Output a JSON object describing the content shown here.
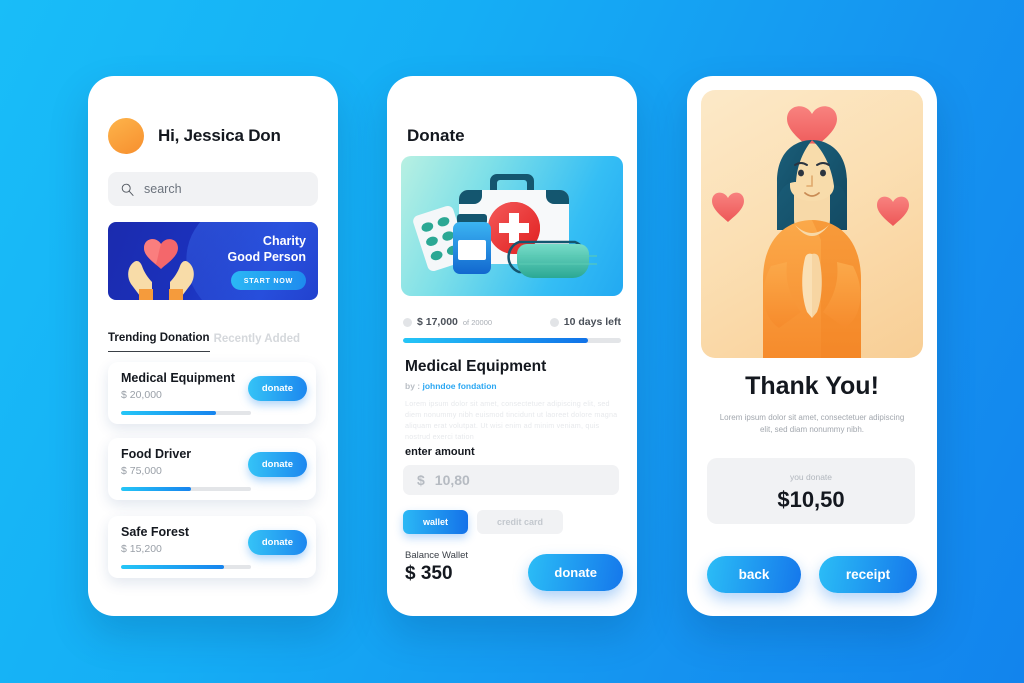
{
  "theme": {
    "bg_start": "#19BDF8",
    "bg_end": "#1284ED",
    "accent_blue": "#1C87EF",
    "accent_cyan": "#35C3F6",
    "avatar_orange": "#F78F2E",
    "heart_coral": "#F26A6A"
  },
  "screen1": {
    "greeting": "Hi, Jessica Don",
    "avatar_icon": "user-avatar",
    "search": {
      "placeholder": "search",
      "icon": "search-icon",
      "value": ""
    },
    "banner": {
      "line1": "Charity",
      "line2": "Good Person",
      "cta": "START NOW",
      "illustration": "hands-holding-heart"
    },
    "tabs": [
      {
        "label": "Trending Donation",
        "active": true
      },
      {
        "label": "Recently Added",
        "active": false
      }
    ],
    "donations": [
      {
        "title": "Medical Equipment",
        "amount": "$ 20,000",
        "progress": 73,
        "button": "donate"
      },
      {
        "title": "Food Driver",
        "amount": "$ 75,000",
        "progress": 54,
        "button": "donate"
      },
      {
        "title": "Safe Forest",
        "amount": "$ 15,200",
        "progress": 79,
        "button": "donate"
      }
    ]
  },
  "screen2": {
    "title": "Donate",
    "hero_illustration": "first-aid-kit",
    "raised_icon": "coin-icon",
    "raised_amount": "$ 17,000",
    "raised_of": "of 20000",
    "time_icon": "clock-icon",
    "time_left": "10 days left",
    "progress": 85,
    "campaign_title": "Medical Equipment",
    "by_prefix": "by : ",
    "by_name": "johndoe fondation",
    "description": "Lorem ipsum dolor sit amet, consectetuer adipiscing elit, sed diem nonummy nibh euismod tincidunt ut laoreet dolore magna aliquam erat volutpat. Ut wisi enim ad minim veniam, quis nostrud exerci tation",
    "amount_label": "enter amount",
    "amount_currency": "$",
    "amount_value": "10,80",
    "payment_methods": [
      {
        "label": "wallet",
        "active": true
      },
      {
        "label": "credit card",
        "active": false
      }
    ],
    "balance_label": "Balance Wallet",
    "balance_value": "$ 350",
    "donate_button": "donate"
  },
  "screen3": {
    "illustration": "woman-praying-with-hearts",
    "heading": "Thank You!",
    "subtext": "Lorem ipsum dolor sit amet, consectetuer adipiscing elit, sed diam nonummy nibh.",
    "donated_label": "you donate",
    "donated_value": "$10,50",
    "back_button": "back",
    "receipt_button": "receipt"
  }
}
